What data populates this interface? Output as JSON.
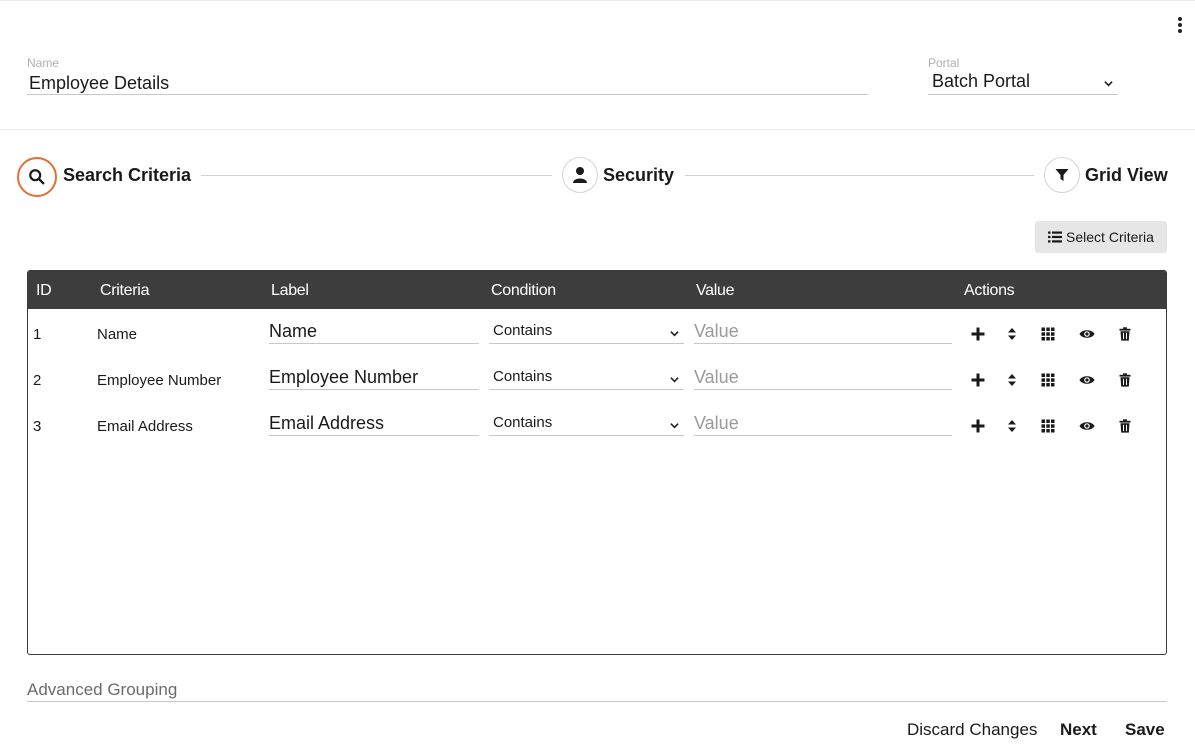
{
  "form": {
    "name_label": "Name",
    "name_value": "Employee Details",
    "portal_label": "Portal",
    "portal_value": "Batch Portal"
  },
  "steps": [
    {
      "label": "Search Criteria",
      "icon": "search-icon",
      "active": true
    },
    {
      "label": "Security",
      "icon": "user-icon",
      "active": false
    },
    {
      "label": "Grid View",
      "icon": "filter-icon",
      "active": false
    }
  ],
  "toolbar": {
    "select_criteria_label": "Select Criteria",
    "select_criteria_icon": "list-icon"
  },
  "grid": {
    "columns": [
      "ID",
      "Criteria",
      "Label",
      "Condition",
      "Value",
      "Actions"
    ],
    "rows": [
      {
        "id": "1",
        "criteria": "Name",
        "label": "Name",
        "condition": "Contains",
        "value_placeholder": "Value"
      },
      {
        "id": "2",
        "criteria": "Employee Number",
        "label": "Employee Number",
        "condition": "Contains",
        "value_placeholder": "Value"
      },
      {
        "id": "3",
        "criteria": "Email Address",
        "label": "Email Address",
        "condition": "Contains",
        "value_placeholder": "Value"
      }
    ],
    "action_icons": [
      "plus-icon",
      "sort-icon",
      "grid-icon",
      "eye-icon",
      "trash-icon"
    ]
  },
  "advanced_grouping_label": "Advanced Grouping",
  "footer": {
    "discard_label": "Discard Changes",
    "next_label": "Next",
    "save_label": "Save"
  },
  "colors": {
    "accent": "#e2702f",
    "header_bg": "#3d3d3d"
  }
}
